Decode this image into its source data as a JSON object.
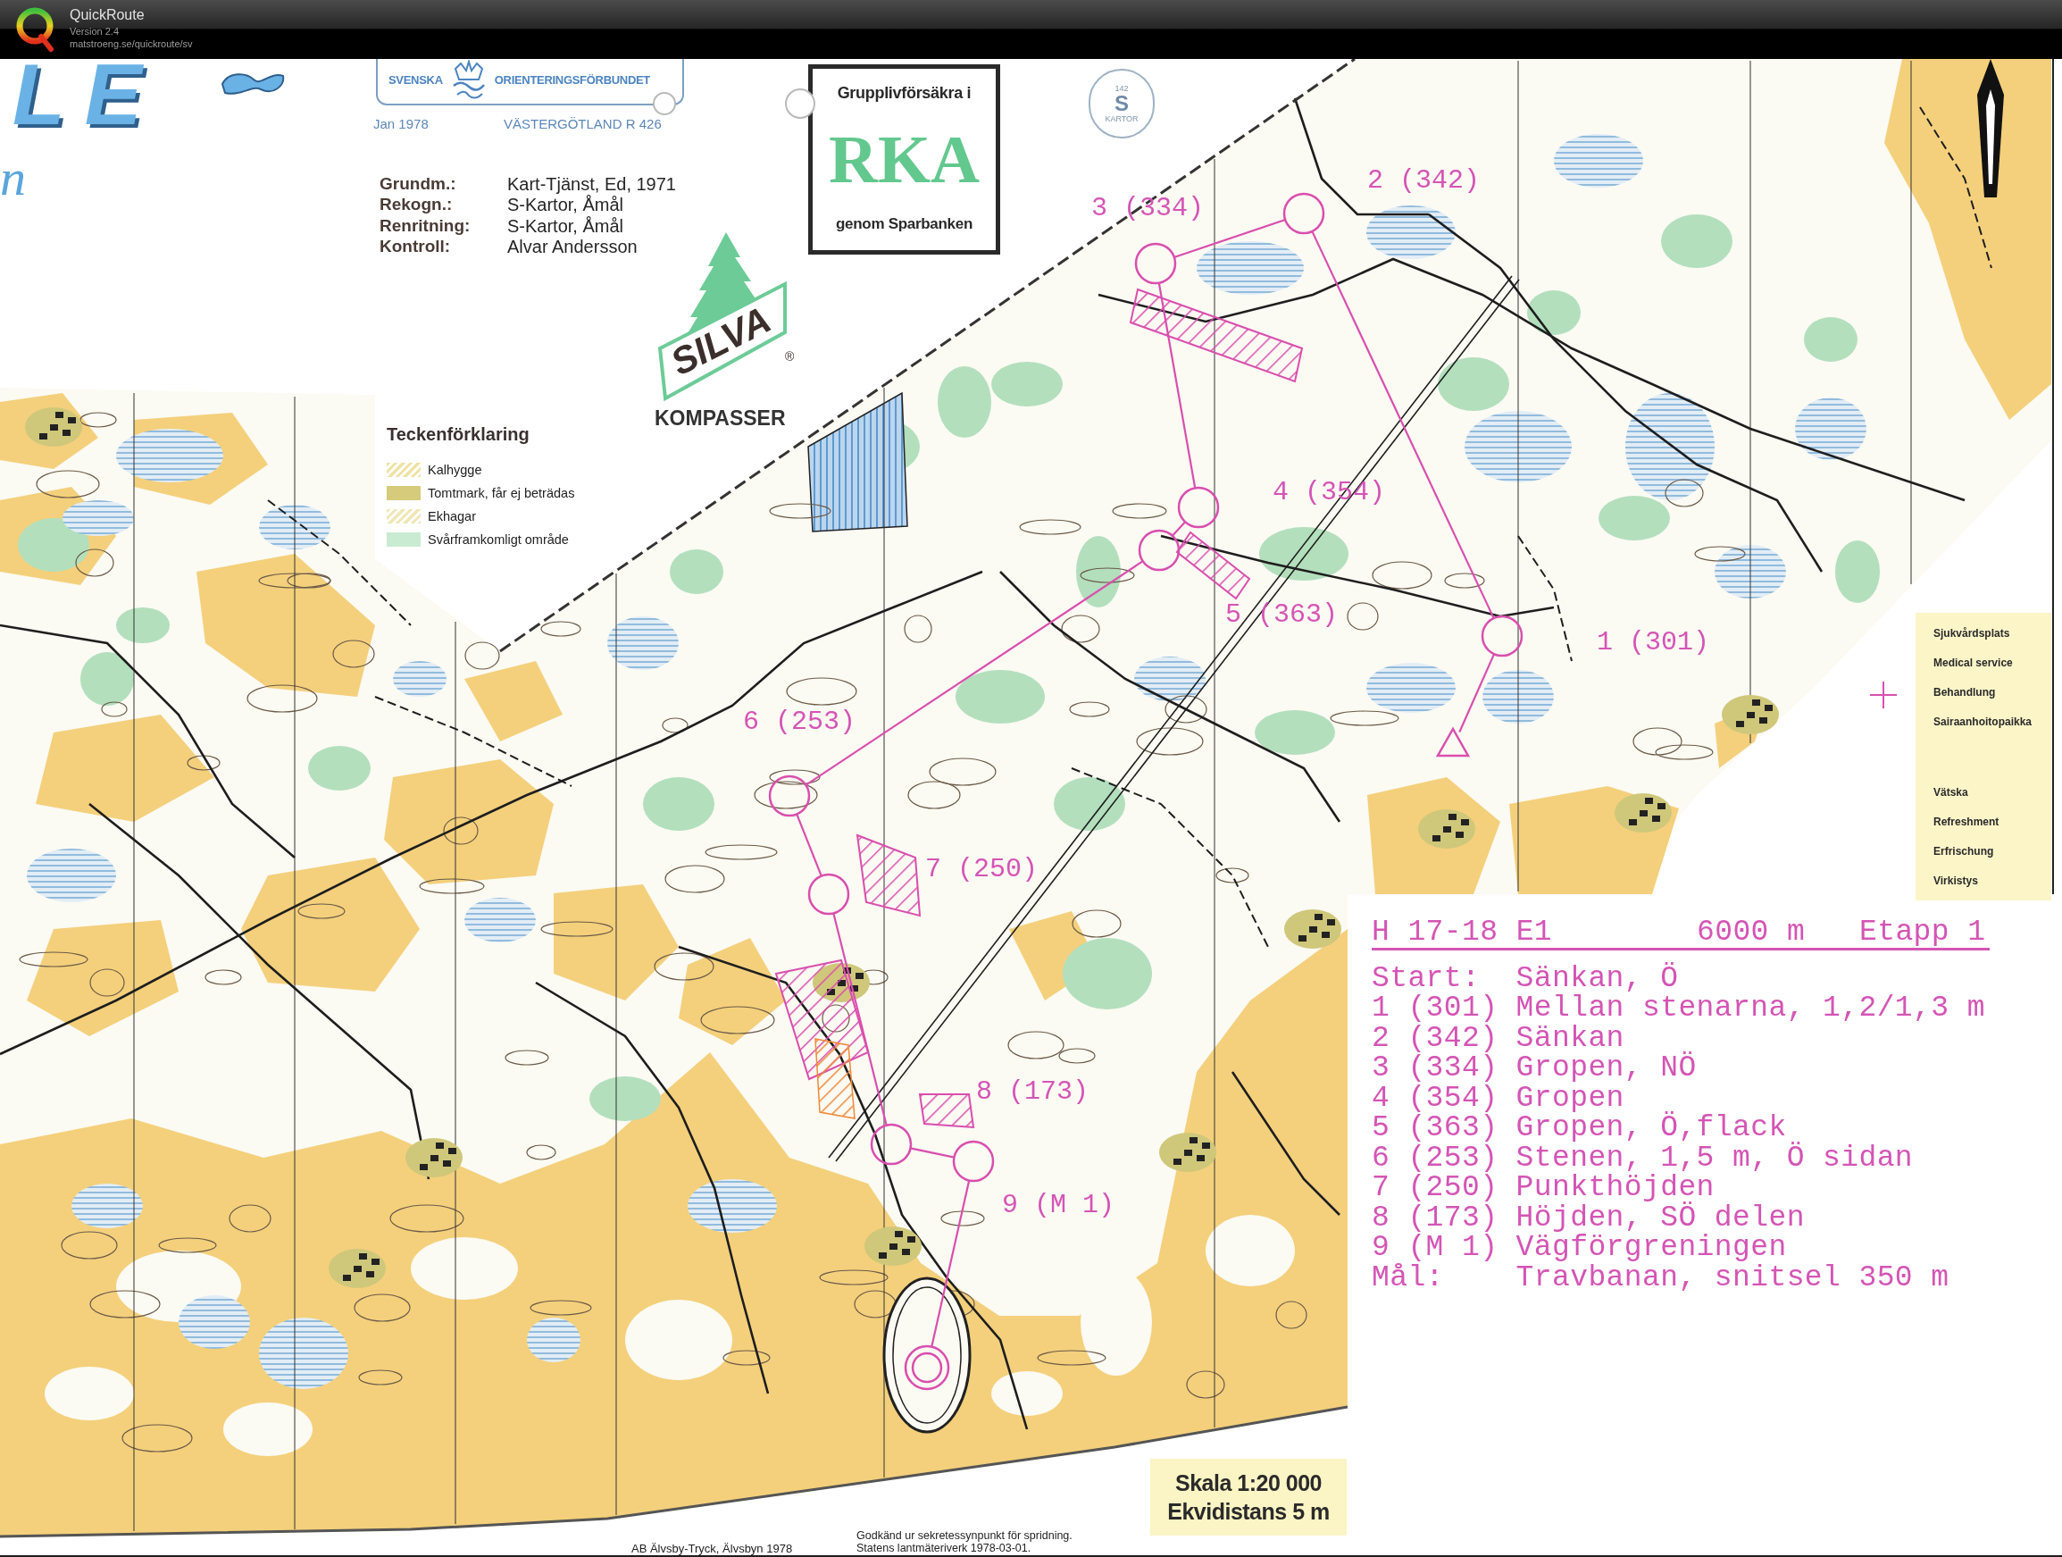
{
  "app": {
    "title": "QuickRoute",
    "version": "Version 2.4",
    "url": "matstroeng.se/quickroute/sv"
  },
  "map": {
    "title_fragments": [
      "LE",
      "n"
    ],
    "federation": {
      "name_left": "SVENSKA",
      "name_right": "ORIENTERINGSFÖRBUNDET",
      "date": "Jan 1978",
      "region": "VÄSTERGÖTLAND R 426"
    },
    "credits": [
      {
        "label": "Grundm.:",
        "value": "Kart-Tjänst, Ed, 1971"
      },
      {
        "label": "Rekogn.:",
        "value": "S-Kartor, Åmål"
      },
      {
        "label": "Renritning:",
        "value": "S-Kartor, Åmål"
      },
      {
        "label": "Kontroll:",
        "value": "Alvar Andersson"
      }
    ],
    "sponsor": {
      "top": "Grupplivförsäkra i",
      "name": "RKA",
      "bottom": "genom Sparbanken"
    },
    "stamp": {
      "number": "142",
      "logo": "S",
      "name": "KARTOR"
    },
    "compass_ad": {
      "brand": "SILVA",
      "mark": "®",
      "product": "KOMPASSER"
    },
    "legend": {
      "title": "Teckenförklaring",
      "items": [
        {
          "label": "Kalhygge",
          "kind": "hatch",
          "color": "#efe3a6"
        },
        {
          "label": "Tomtmark, får ej beträdas",
          "kind": "solid",
          "color": "#d6cb7a"
        },
        {
          "label": "Ekhagar",
          "kind": "hatch",
          "color": "#f1e6b6"
        },
        {
          "label": "Svårframkomligt område",
          "kind": "solid",
          "color": "#c8ebd2"
        }
      ]
    },
    "control_labels": [
      "2 (342)",
      "3 (334)",
      "4 (354)",
      "5 (363)",
      "1 (301)",
      "6 (253)",
      "7 (250)",
      "8 (173)",
      "9 (M 1)"
    ],
    "service_legend": [
      {
        "lines": [
          "Sjukvårdsplats",
          "Medical service",
          "Behandlung",
          "Sairaanhoitopaikka"
        ]
      },
      {
        "lines": [
          "Vätska",
          "Refreshment",
          "Erfrischung",
          "Virkistys"
        ]
      }
    ],
    "course_sheet": {
      "class": "H 17-18 E1",
      "length": "6000 m",
      "stage": "Etapp 1",
      "rows": [
        {
          "kind": "start",
          "label": "Start:",
          "description": "Sänkan, Ö"
        },
        {
          "kind": "control",
          "number": "1",
          "code": "(301)",
          "description": "Mellan stenarna, 1,2/1,3 m"
        },
        {
          "kind": "control",
          "number": "2",
          "code": "(342)",
          "description": "Sänkan"
        },
        {
          "kind": "control",
          "number": "3",
          "code": "(334)",
          "description": "Gropen, NÖ"
        },
        {
          "kind": "control",
          "number": "4",
          "code": "(354)",
          "description": "Gropen"
        },
        {
          "kind": "control",
          "number": "5",
          "code": "(363)",
          "description": "Gropen, Ö,flack"
        },
        {
          "kind": "control",
          "number": "6",
          "code": "(253)",
          "description": "Stenen, 1,5 m, Ö sidan"
        },
        {
          "kind": "control",
          "number": "7",
          "code": "(250)",
          "description": "Punkthöjden"
        },
        {
          "kind": "control",
          "number": "8",
          "code": "(173)",
          "description": "Höjden, SÖ delen"
        },
        {
          "kind": "control",
          "number": "9",
          "code": "(M 1)",
          "description": "Vägförgreningen"
        },
        {
          "kind": "finish",
          "label": "Mål:",
          "description": "Travbanan, snitsel 350 m"
        }
      ]
    },
    "scale_box": {
      "scale": "Skala 1:20 000",
      "contour_interval": "Ekvidistans 5 m"
    },
    "footer": {
      "printer": "AB Älvsby-Tryck, Älvsbyn 1978",
      "approval": [
        "Godkänd ur sekretessynpunkt för spridning.",
        "Statens lantmäteriverk 1978-03-01."
      ]
    }
  }
}
